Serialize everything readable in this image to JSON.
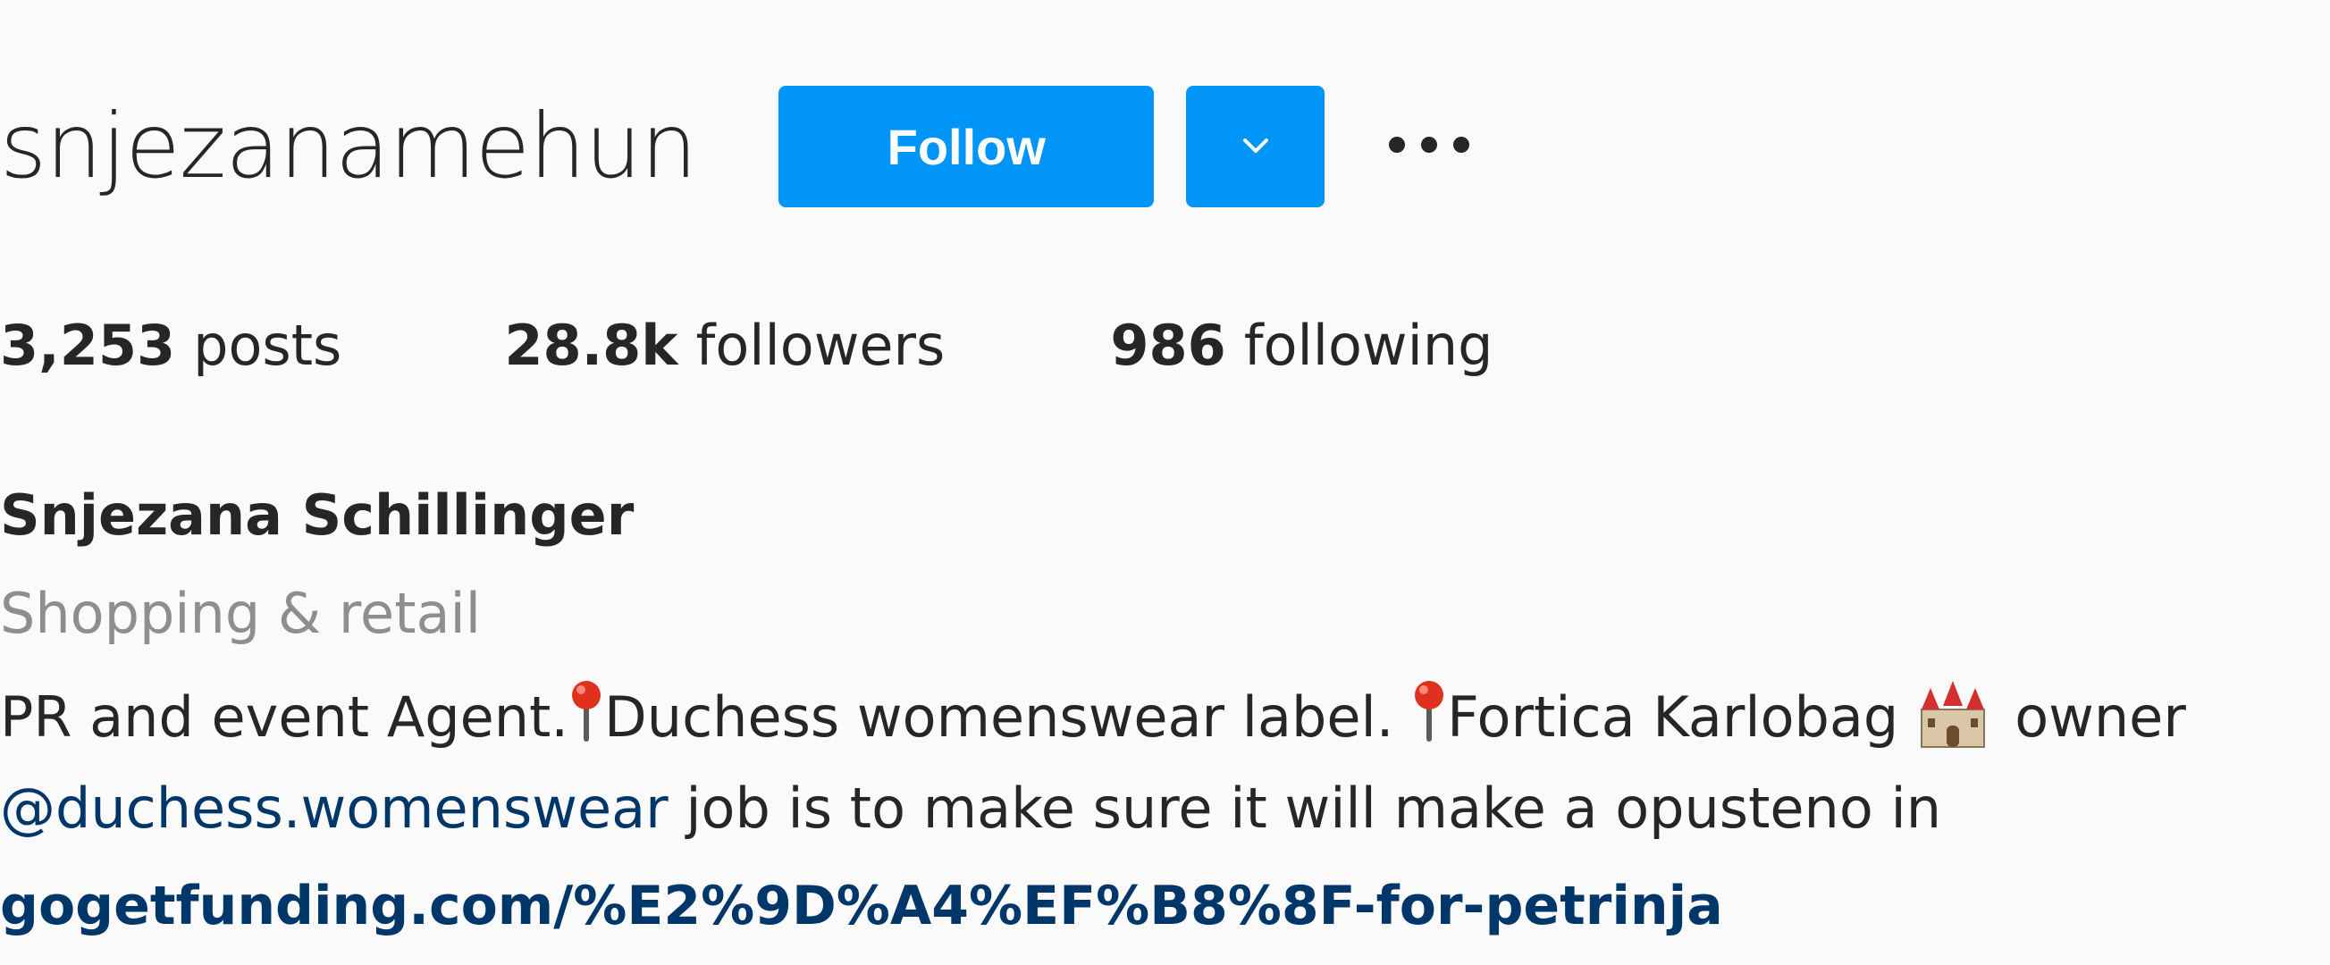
{
  "profile": {
    "username": "snjezanamehun",
    "follow_label": "Follow",
    "stats": {
      "posts_count": "3,253",
      "posts_label": "posts",
      "followers_count": "28.8k",
      "followers_label": "followers",
      "following_count": "986",
      "following_label": "following"
    },
    "full_name": "Snjezana Schillinger",
    "category": "Shopping & retail",
    "bio": {
      "line1_part1": "PR and event Agent.",
      "line1_part2": "Duchess womenswear label. ",
      "line1_part3": "Fortica Karlobag",
      "line1_part4": "owner",
      "mention": "@duchess.womenswear",
      "line2_rest": " job is to make sure it will make a opusteno in",
      "link": "gogetfunding.com/%E2%9D%A4%EF%B8%8F-for-petrinja"
    },
    "colors": {
      "accent": "#0095f6",
      "link": "#00376b",
      "secondary_text": "#8e8e8e",
      "primary_text": "#262626",
      "background": "#fafafa"
    },
    "icons": [
      "chevron-down-icon",
      "more-options-icon",
      "round-pushpin-icon",
      "castle-icon"
    ]
  }
}
